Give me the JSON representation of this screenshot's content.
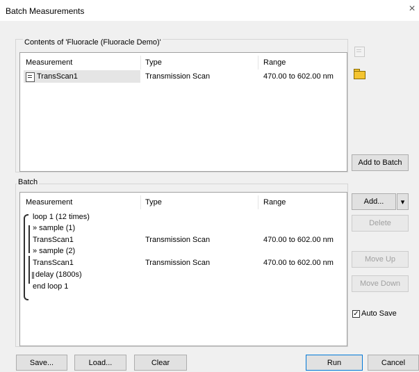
{
  "window": {
    "title": "Batch Measurements",
    "close_glyph": "×"
  },
  "contents": {
    "label": "Contents of 'Fluoracle (Fluoracle Demo)'",
    "columns": [
      "Measurement",
      "Type",
      "Range"
    ],
    "rows": [
      {
        "name": "TransScan1",
        "type": "Transmission Scan",
        "range": "470.00 to 602.00 nm"
      }
    ],
    "add_to_batch_label": "Add to Batch",
    "icons": [
      "properties-icon",
      "open-folder-icon"
    ]
  },
  "batch": {
    "label": "Batch",
    "columns": [
      "Measurement",
      "Type",
      "Range"
    ],
    "rows": [
      {
        "name": "loop 1 (12 times)",
        "type": "",
        "range": ""
      },
      {
        "name": "» sample (1)",
        "type": "",
        "range": ""
      },
      {
        "name": "TransScan1",
        "type": "Transmission Scan",
        "range": "470.00 to 602.00 nm"
      },
      {
        "name": "» sample (2)",
        "type": "",
        "range": ""
      },
      {
        "name": "TransScan1",
        "type": "Transmission Scan",
        "range": "470.00 to 602.00 nm"
      },
      {
        "name": "delay (1800s)",
        "type": "",
        "range": ""
      },
      {
        "name": "end loop 1",
        "type": "",
        "range": ""
      }
    ],
    "add_label": "Add...",
    "dropdown_glyph": "▾",
    "delete_label": "Delete",
    "move_up_label": "Move Up",
    "move_down_label": "Move Down",
    "auto_save_label": "Auto Save",
    "auto_save_checked": true,
    "check_glyph": "✓"
  },
  "footer": {
    "save_label": "Save...",
    "load_label": "Load...",
    "clear_label": "Clear",
    "run_label": "Run",
    "cancel_label": "Cancel"
  },
  "colors": {
    "accent": "#0078d7",
    "folder": "#f4c430",
    "disabled_text": "#a0a0a0"
  }
}
